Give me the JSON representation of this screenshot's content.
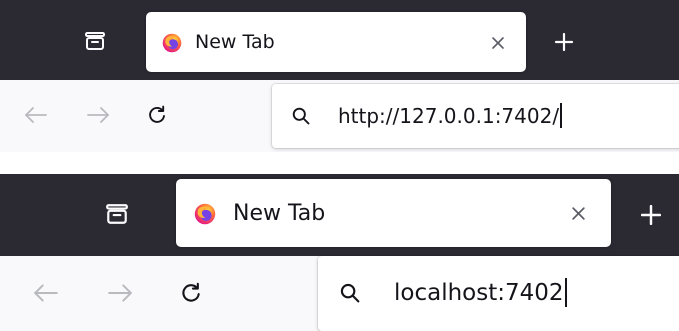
{
  "screenshots": [
    {
      "tab": {
        "title": "New Tab",
        "favicon": "firefox-logo-icon",
        "close_icon": "close-icon"
      },
      "toolbar": {
        "list_all_tabs_icon": "list-all-tabs-icon",
        "new_tab_icon": "plus-icon",
        "back_icon": "arrow-left-icon",
        "forward_icon": "arrow-right-icon",
        "reload_icon": "reload-icon"
      },
      "urlbar": {
        "search_icon": "search-icon",
        "value": "http://127.0.0.1:7402/"
      }
    },
    {
      "tab": {
        "title": "New Tab",
        "favicon": "firefox-logo-icon",
        "close_icon": "close-icon"
      },
      "toolbar": {
        "list_all_tabs_icon": "list-all-tabs-icon",
        "new_tab_icon": "plus-icon",
        "back_icon": "arrow-left-icon",
        "forward_icon": "arrow-right-icon",
        "reload_icon": "reload-icon"
      },
      "urlbar": {
        "search_icon": "search-icon",
        "value": "localhost:7402"
      }
    }
  ],
  "colors": {
    "tabbar_bg": "#2b2a33",
    "tabbar_icon": "#fbfbfe",
    "navbar_bg": "#f9f9fb",
    "nav_icon_disabled": "#b9b9c0",
    "nav_icon": "#15141a",
    "text": "#15141a"
  }
}
